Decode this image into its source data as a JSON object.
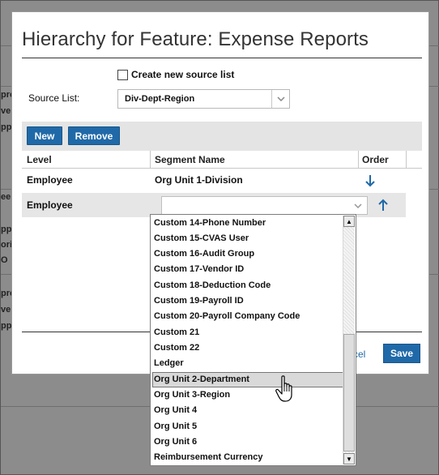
{
  "background": {
    "fragments": [
      "pro",
      "ver",
      "ppr",
      "ee",
      "ppr",
      "ori",
      "O",
      "pro",
      "ver",
      "ppr"
    ]
  },
  "dialog": {
    "title": "Hierarchy for Feature: Expense Reports",
    "create_new_label": "Create new source list",
    "create_new_checked": false,
    "source_list_label": "Source List:",
    "source_list_value": "Div-Dept-Region",
    "toolbar": {
      "new_label": "New",
      "remove_label": "Remove"
    },
    "table": {
      "headers": {
        "level": "Level",
        "segment": "Segment Name",
        "order": "Order"
      },
      "rows": [
        {
          "level": "Employee",
          "segment": "Org Unit 1-Division",
          "order_icon": "arrow-down-icon"
        },
        {
          "level": "Employee",
          "segment": "",
          "order_icon": "arrow-up-icon"
        }
      ]
    },
    "cancel_fragment": "cel",
    "save_label": "Save",
    "accent_color": "#2069a8"
  },
  "dropdown": {
    "options": [
      "Custom 14-Phone Number",
      "Custom 15-CVAS User",
      "Custom 16-Audit Group",
      "Custom 17-Vendor ID",
      "Custom 18-Deduction Code",
      "Custom 19-Payroll ID",
      "Custom 20-Payroll Company Code",
      "Custom 21",
      "Custom 22",
      "Ledger",
      "Org Unit 2-Department",
      "Org Unit 3-Region",
      "Org Unit 4",
      "Org Unit 5",
      "Org Unit 6",
      "Reimbursement Currency"
    ],
    "highlighted": "Org Unit 2-Department"
  }
}
